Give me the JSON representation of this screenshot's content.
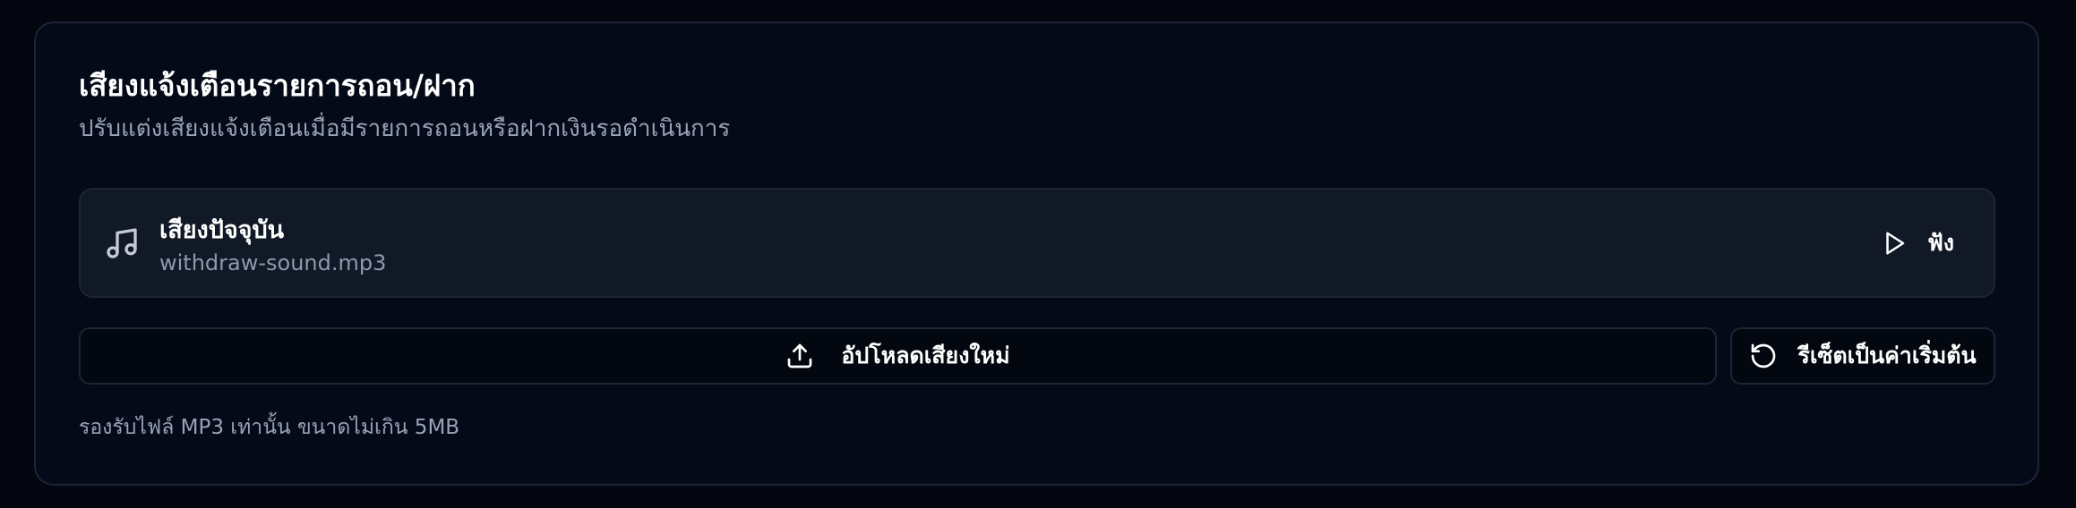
{
  "section": {
    "title": "เสียงแจ้งเตือนรายการถอน/ฝาก",
    "subtitle": "ปรับแต่งเสียงแจ้งเตือนเมื่อมีรายการถอนหรือฝากเงินรอดำเนินการ"
  },
  "current_sound": {
    "icon": "music-note-icon",
    "label": "เสียงปัจจุบัน",
    "file_name": "withdraw-sound.mp3",
    "listen_icon": "play-icon",
    "listen_label": "ฟัง"
  },
  "actions": {
    "upload_icon": "upload-icon",
    "upload_label": "อัปโหลดเสียงใหม่",
    "reset_icon": "reset-icon",
    "reset_label": "รีเซ็ตเป็นค่าเริ่มต้น"
  },
  "hint": "รองรับไฟล์ MP3 เท่านั้น ขนาดไม่เกิน 5MB",
  "colors": {
    "page_background": "#03060f",
    "card_background": "#050a18",
    "border": "#1c2435",
    "panel_background": "#111826",
    "text_primary": "#ffffff",
    "text_secondary": "#98a3b8"
  }
}
